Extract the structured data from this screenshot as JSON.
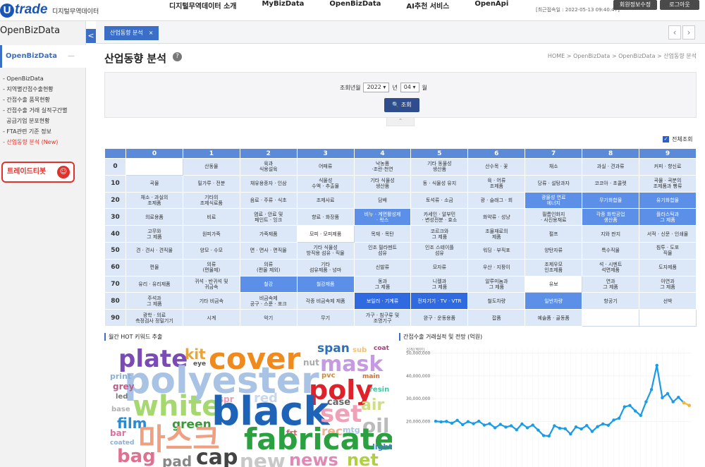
{
  "header": {
    "logo": "trade",
    "logo_u": "U",
    "logo_sub": "디지털무역데이터",
    "nav": [
      "디지털무역데이터 소개",
      "MyBizData",
      "OpenBizData",
      "AI추천 서비스",
      "OpenApi"
    ],
    "last_update": "[최근접속일 : 2022-05-13 09:40:47]",
    "btn_profile": "회원정보수정",
    "btn_logout": "로그아웃"
  },
  "sidebar": {
    "title": "OpenBizData",
    "toggle": "<",
    "sub": "OpenBizData",
    "sub_dash": "—",
    "menu": [
      "- OpenBizData",
      "- 지역별간접수출현황",
      "- 간접수출 품목현황",
      "- 간접수출 거래 실적구간별",
      "  공급기업 분포현황",
      "- FTA관련 기준 정보",
      "- 산업동향 분석 (New)"
    ],
    "trade_btn": "트레이드티봇",
    "robot": "☺"
  },
  "tabs": {
    "active": "산업동향 분석",
    "close": "×",
    "prev": "‹",
    "next": "›"
  },
  "page": {
    "title": "산업동향 분석",
    "help": "?",
    "breadcrumb": "HOME  >  OpenBizData  >  OpenBizData  >  산업동향 분석"
  },
  "search": {
    "label": "조회년월",
    "year": "2022",
    "year_unit": "년",
    "month": "04",
    "month_unit": "월",
    "dropdown": "▾",
    "button": "🔍 조회",
    "collapse": "⌃"
  },
  "select_all": {
    "label": "전체조회",
    "check": "✓"
  },
  "grid": {
    "columns": [
      "",
      "0",
      "1",
      "2",
      "3",
      "4",
      "5",
      "6",
      "7",
      "8",
      "9"
    ],
    "rows": [
      {
        "head": "0",
        "cells": [
          "",
          "산동물",
          "육과\n식용설육",
          "어패류",
          "낙농품\n·조란·천연",
          "기타 동물성\n생산품",
          "산수목 · 꽃",
          "채소",
          "과실 · 견과류",
          "커피 · 향신료"
        ]
      },
      {
        "head": "10",
        "cells": [
          "곡물",
          "밀가루 · 전분",
          "채유용종자 · 인삼",
          "식물성\n수액 · 추출물",
          "기타 식물성\n생산품",
          "동 · 식물성 유지",
          "육 · 어류\n조제품",
          "당류 · 설탕과자",
          "코코아 · 초콜렛",
          "곡물 · 곡분의\n조제품과 빵류"
        ]
      },
      {
        "head": "20",
        "cells": [
          "채소 · 과실의\n조제품",
          "기타의\n조제식료품",
          "음료 · 주류 · 식초",
          "조제사료",
          "담배",
          "토석류 · 소금",
          "광 · 슬래그 · 회",
          "광물성 연료\n에너지",
          "무기화합물",
          "유기화합물"
        ]
      },
      {
        "head": "30",
        "cells": [
          "의료용품",
          "비료",
          "염료 · 안료 및\n페인트 · 잉크",
          "향료 · 화장품",
          "비누 · 계면활성제\n· 왁스",
          "카세인 · 알부민\n· 변성전분 · 효소",
          "화약류 · 성냥",
          "필름인화지\n· 사진용재료",
          "각종 화학공업\n생산품",
          "플라스틱과\n그 제품"
        ]
      },
      {
        "head": "40",
        "cells": [
          "고무와\n그 제품",
          "원피가죽",
          "가죽제품",
          "모피 · 모피제품",
          "목재 · 목탄",
          "코르크와\n그 제품",
          "조물재료의\n제품",
          "펄프",
          "지와 판지",
          "서적 · 신문 · 인쇄물"
        ]
      },
      {
        "head": "50",
        "cells": [
          "견 · 견사 · 견직물",
          "양모 · 수모",
          "면 · 면사 · 면직물",
          "기타 식물성\n방직용 섬유 · 직물",
          "인조 필라멘트\n섬유",
          "인조 스테이플\n섬유",
          "워딩 · 부직포",
          "양탄자류",
          "특수직물",
          "침투 · 도포\n직물"
        ]
      },
      {
        "head": "60",
        "cells": [
          "편물",
          "의류\n(편물제)",
          "의류\n(편물 제외)",
          "기타\n섬유제품 · 넝마",
          "신발류",
          "모자류",
          "우산 · 지팡이",
          "조제우모\n인조제품",
          "석 · 시멘트\n석면제품",
          "도자제품"
        ]
      },
      {
        "head": "70",
        "cells": [
          "유리 · 유리제품",
          "귀석 · 반귀석 및\n귀금속",
          "철강",
          "철강제품",
          "동과\n그 제품",
          "니켈과\n그 제품",
          "알루미늄과\n그 제품",
          "유보",
          "연과\n그 제품",
          "아연과\n그 제품"
        ]
      },
      {
        "head": "80",
        "cells": [
          "주석과\n그 제품",
          "기타 비금속",
          "비금속제\n공구 · 스푼 · 포크",
          "각종 비금속제 제품",
          "보일러 · 기계류",
          "전자기기 · TV · VTR",
          "철도차량",
          "일반차량",
          "항공기",
          "선박"
        ]
      },
      {
        "head": "90",
        "cells": [
          "광학 · 의료\n측정검사 정밀기기",
          "시계",
          "악기",
          "무기",
          "가구 · 침구류 및\n조명기구",
          "완구 · 운동용품",
          "잡품",
          "예술품 · 골동품",
          "",
          ""
        ]
      }
    ]
  },
  "panels": {
    "cloud_title": "월간 HOT 키워드 추출",
    "chart_title": "간접수출 거래실적 및 전망 (억원)"
  },
  "cloud_words": [
    {
      "w": "plate",
      "c": "#7a4ab5"
    },
    {
      "w": "kit",
      "c": "#e8a43a"
    },
    {
      "w": "eye",
      "c": "#555"
    },
    {
      "w": "cover",
      "c": "#f08a1c"
    },
    {
      "w": "span",
      "c": "#2e6fb5"
    },
    {
      "w": "sub",
      "c": "#f0c080"
    },
    {
      "w": "coat",
      "c": "#b0407a"
    },
    {
      "w": "mask",
      "c": "#c49ae0"
    },
    {
      "w": "nut",
      "c": "#aaa"
    },
    {
      "w": "pvc",
      "c": "#d08a40"
    },
    {
      "w": "main",
      "c": "#e06a2a"
    },
    {
      "w": "polyester",
      "c": "#a9c3e4"
    },
    {
      "w": "poly",
      "c": "#e0202a"
    },
    {
      "w": "print",
      "c": "#8ab0d8"
    },
    {
      "w": "grey",
      "c": "#c05a8a"
    },
    {
      "w": "led",
      "c": "#777"
    },
    {
      "w": "resin",
      "c": "#4ac0a0"
    },
    {
      "w": "white",
      "c": "#a6d870"
    },
    {
      "w": "spr",
      "c": "#ef9ab5"
    },
    {
      "w": "red",
      "c": "#c8d8ea"
    },
    {
      "w": "black",
      "c": "#1d64b8"
    },
    {
      "w": "case",
      "c": "#666"
    },
    {
      "w": "set",
      "c": "#f2a0b8"
    },
    {
      "w": "air",
      "c": "#d0e080"
    },
    {
      "w": "base",
      "c": "#b0b0b0"
    },
    {
      "w": "film",
      "c": "#2e8ad0"
    },
    {
      "w": "green",
      "c": "#3a9a3a"
    },
    {
      "w": "oil",
      "c": "#bbb"
    },
    {
      "w": "bar",
      "c": "#e070a0"
    },
    {
      "w": "frt",
      "c": "#d06070"
    },
    {
      "w": "rec",
      "c": "#f0b090"
    },
    {
      "w": "mtg",
      "c": "#aac4e0"
    },
    {
      "w": "coated",
      "c": "#88b0d8"
    },
    {
      "w": "마스크",
      "c": "#f0a080"
    },
    {
      "w": "fabricate",
      "c": "#2aa040"
    },
    {
      "w": "light",
      "c": "#3a80c0"
    },
    {
      "w": "bag",
      "c": "#e07090"
    },
    {
      "w": "pad",
      "c": "#888"
    },
    {
      "w": "cap",
      "c": "#444"
    },
    {
      "w": "new",
      "c": "#c8c8c8"
    },
    {
      "w": "news",
      "c": "#e088b8"
    },
    {
      "w": "net",
      "c": "#b0d040"
    }
  ],
  "chart_data": {
    "type": "line",
    "title": "간접수출 거래실적 및 전망 (억원)",
    "ylabel": "실적(백만)",
    "yticks": [
      "50,000,000",
      "40,000,000",
      "30,000,000",
      "20,000,000"
    ],
    "ylim": [
      0,
      52000000
    ],
    "series": [
      {
        "values": [
          20100000,
          19800000,
          20000000,
          19200000,
          20500000,
          18600000,
          19900000,
          19000000,
          20100000,
          18400000,
          19000000,
          17200000,
          18700000,
          17500000,
          18100000,
          16300000,
          18900000,
          17200000,
          18400000,
          16200000,
          13800000,
          13600000,
          18100000,
          17000000,
          16800000,
          14500000,
          17600000,
          16700000,
          18200000,
          15600000,
          17700000,
          18900000,
          18300000,
          20600000,
          21400000,
          26400000,
          27000000,
          24600000,
          22600000,
          28600000,
          34000000,
          44600000,
          30400000,
          32200000,
          28600000,
          30600000,
          28200000
        ]
      },
      {
        "values": [
          28200000,
          27000000
        ]
      }
    ]
  }
}
